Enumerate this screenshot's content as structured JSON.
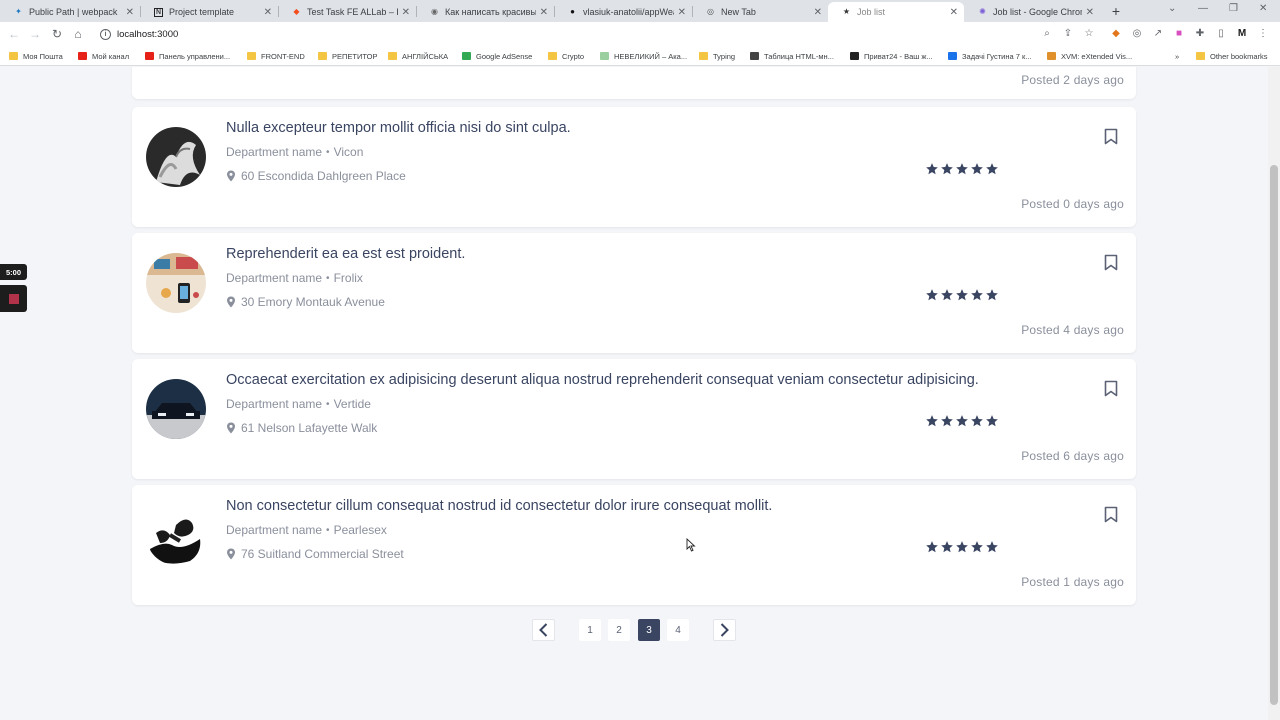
{
  "browser": {
    "tabs": [
      {
        "title": "Public Path | webpack",
        "icon": "webpack-icon",
        "active": false
      },
      {
        "title": "Project template",
        "icon": "notion-icon",
        "active": false
      },
      {
        "title": "Test Task FE ALLab – Figma",
        "icon": "figma-icon",
        "active": false
      },
      {
        "title": "Как написать красивый и",
        "icon": "globe-icon",
        "active": false
      },
      {
        "title": "vlasiuk-anatolii/appWeath",
        "icon": "github-icon",
        "active": false
      },
      {
        "title": "New Tab",
        "icon": "chrome-icon",
        "active": false
      },
      {
        "title": "Job list",
        "icon": "star-icon",
        "active": true
      },
      {
        "title": "Job list - Google Chrome",
        "icon": "react-icon",
        "active": false
      }
    ],
    "url": "localhost:3000",
    "bookmarks": [
      {
        "label": "Моя Пошта",
        "color": "#f4c542"
      },
      {
        "label": "Мой канал",
        "color": "#e62117"
      },
      {
        "label": "Панель управлени...",
        "color": "#e62117"
      },
      {
        "label": "FRONT-END",
        "color": "#f4c542"
      },
      {
        "label": "РЕПЕТИТОР",
        "color": "#f4c542"
      },
      {
        "label": "АНГЛІЙСЬКА",
        "color": "#f4c542"
      },
      {
        "label": "Google AdSense",
        "color": "#34a853"
      },
      {
        "label": "Crypto",
        "color": "#f4c542"
      },
      {
        "label": "НЕВЕЛИКИЙ – Ака...",
        "color": "#9ad0a0"
      },
      {
        "label": "Typing",
        "color": "#f4c542"
      },
      {
        "label": "Таблица HTML-мн...",
        "color": "#444444"
      },
      {
        "label": "Приват24 - Ваш ж...",
        "color": "#222222"
      },
      {
        "label": "Задачі Густина 7 к...",
        "color": "#1a73e8"
      },
      {
        "label": "XVM: eXtended Vis...",
        "color": "#e0902a"
      }
    ],
    "other_bookmarks": "Other bookmarks",
    "more_bookmarks": "»"
  },
  "recorder": {
    "time": "5:00"
  },
  "top_card": {
    "posted": "Posted 2 days ago"
  },
  "jobs": [
    {
      "title": "Nulla excepteur tempor mollit officia nisi do sint culpa.",
      "department": "Department name",
      "company": "Vicon",
      "address": "60 Escondida Dahlgreen Place",
      "rating": 5,
      "posted": "Posted 0 days ago",
      "avatar": "plant"
    },
    {
      "title": "Reprehenderit ea ea est est proident.",
      "department": "Department name",
      "company": "Frolix",
      "address": "30 Emory Montauk Avenue",
      "rating": 5,
      "posted": "Posted 4 days ago",
      "avatar": "desk"
    },
    {
      "title": "Occaecat exercitation ex adipisicing deserunt aliqua nostrud reprehenderit consequat veniam consectetur adipisicing.",
      "department": "Department name",
      "company": "Vertide",
      "address": "61 Nelson Lafayette Walk",
      "rating": 5,
      "posted": "Posted 6 days ago",
      "avatar": "car"
    },
    {
      "title": "Non consectetur cillum consequat nostrud id consectetur dolor irure consequat mollit.",
      "department": "Department name",
      "company": "Pearlesex",
      "address": "76 Suitland Commercial Street",
      "rating": 5,
      "posted": "Posted 1 days ago",
      "avatar": "hands"
    }
  ],
  "pagination": {
    "pages": [
      "1",
      "2",
      "3",
      "4"
    ],
    "current": "3"
  },
  "colors": {
    "primary": "#3a4562",
    "muted": "#8a8f9c",
    "background": "#f4f5f8",
    "active_page": "#3a4562"
  }
}
